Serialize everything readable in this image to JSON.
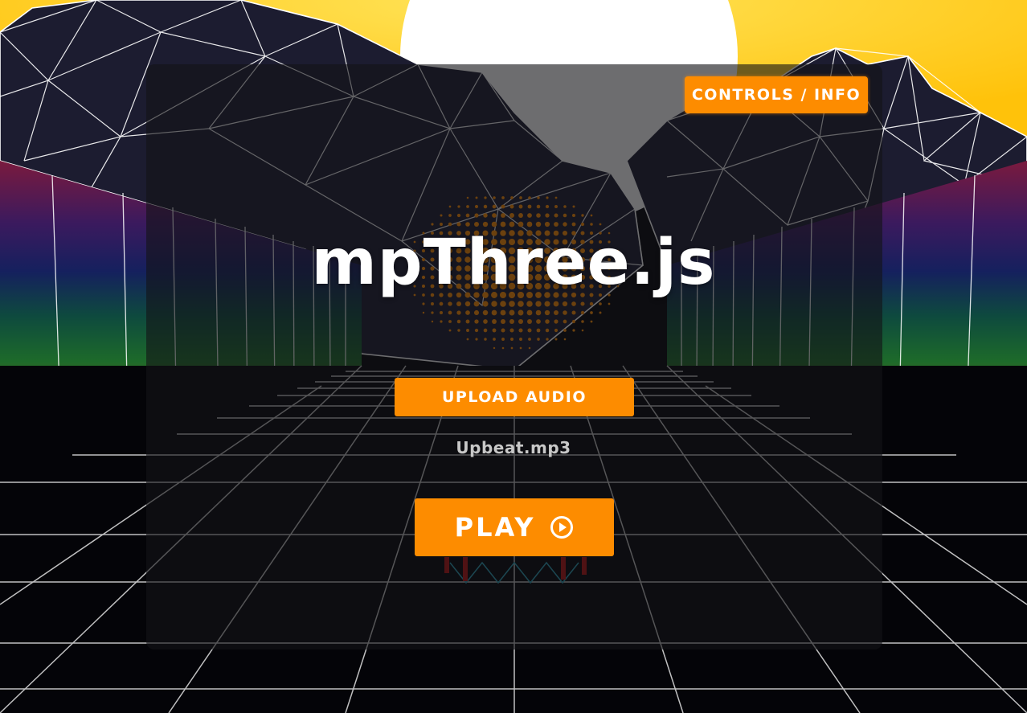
{
  "app": {
    "title": "mpThree.js"
  },
  "toolbar": {
    "controls_label": "CONTROLS / INFO"
  },
  "upload": {
    "label": "UPLOAD AUDIO",
    "filename": "Upbeat.mp3"
  },
  "player": {
    "play_label": "PLAY",
    "play_icon": "play-circle-icon"
  },
  "colors": {
    "accent": "#fd8c00",
    "sun": "#ffd21a",
    "grid": "#ffffff",
    "background": "#05050a"
  }
}
